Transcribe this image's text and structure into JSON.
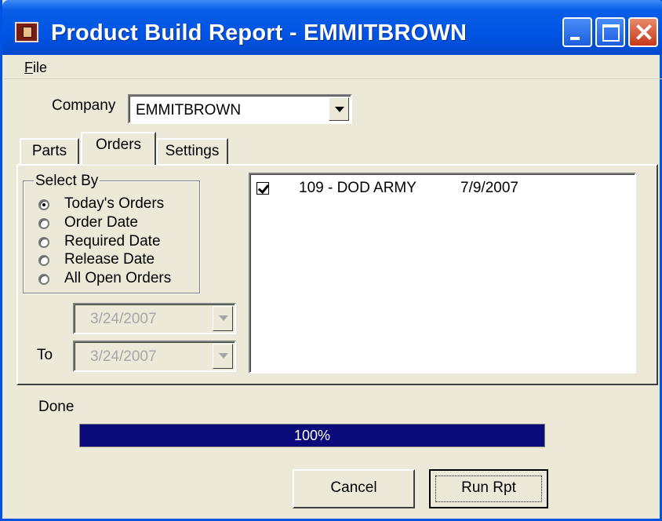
{
  "window": {
    "title": "Product Build Report - EMMITBROWN"
  },
  "menu": {
    "file_mnemonic": "F",
    "file_rest": "ile"
  },
  "company": {
    "label": "Company",
    "selected": "EMMITBROWN"
  },
  "tabs": [
    {
      "label": "Parts",
      "active": false
    },
    {
      "label": "Orders",
      "active": true
    },
    {
      "label": "Settings",
      "active": false
    }
  ],
  "select_by": {
    "title": "Select By",
    "options": [
      {
        "label": "Today's Orders",
        "checked": true
      },
      {
        "label": "Order Date",
        "checked": false
      },
      {
        "label": "Required Date",
        "checked": false
      },
      {
        "label": "Release Date",
        "checked": false
      },
      {
        "label": "All Open Orders",
        "checked": false
      }
    ]
  },
  "date_range": {
    "from_value": "3/24/2007",
    "to_label": "To",
    "to_value": "3/24/2007",
    "enabled": false
  },
  "orders": [
    {
      "checked": true,
      "order": "109 - DOD ARMY",
      "date": "7/9/2007"
    }
  ],
  "status": {
    "text": "Done",
    "progress_percent": 100,
    "progress_label": "100%"
  },
  "buttons": {
    "cancel": "Cancel",
    "run": "Run Rpt"
  },
  "colors": {
    "titlebar": "#0055e5",
    "progress_fill": "#0a0a7a",
    "window_bg": "#ece9d8"
  }
}
